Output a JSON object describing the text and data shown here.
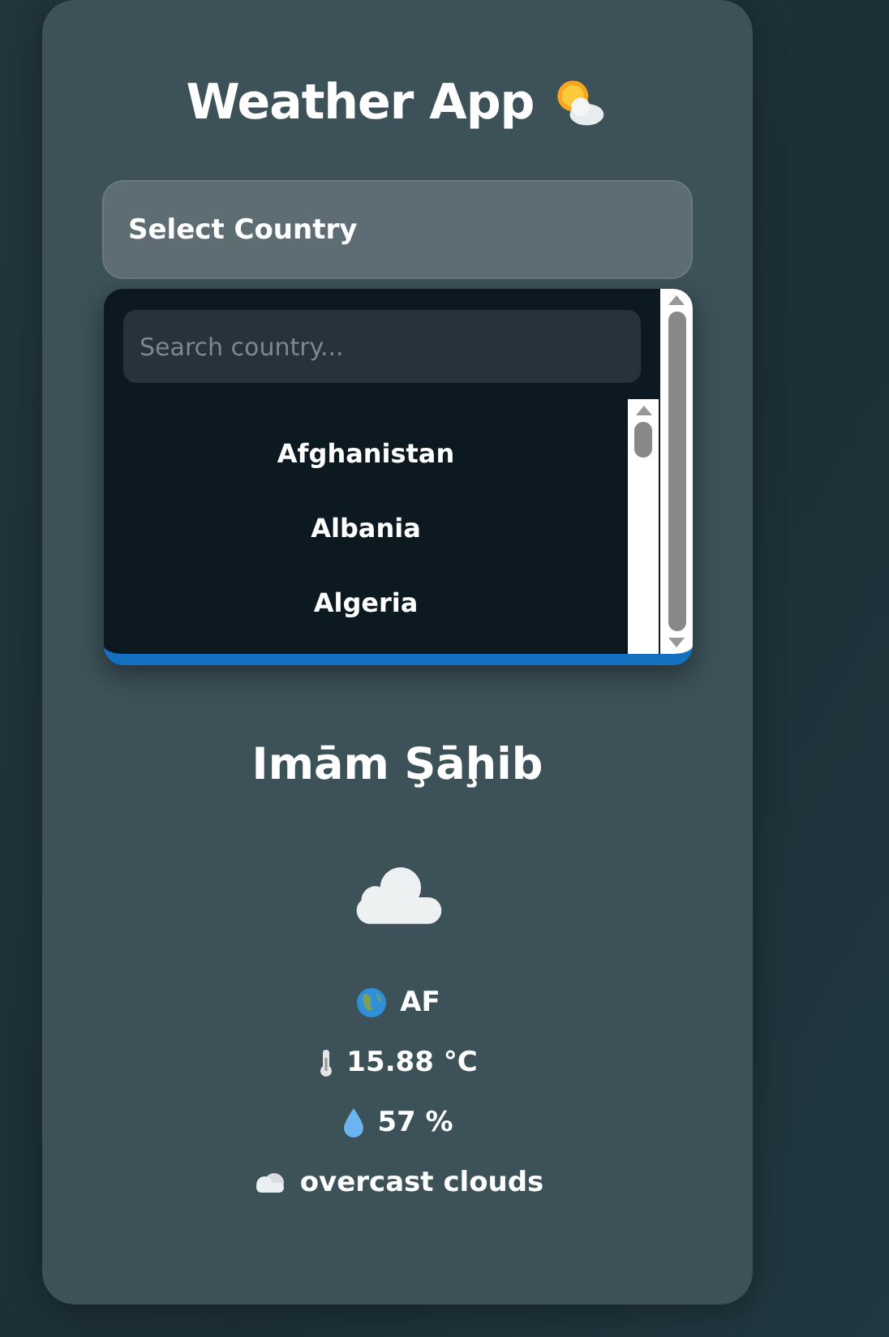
{
  "app": {
    "title": "Weather App"
  },
  "country_select": {
    "label": "Select Country",
    "expanded": true
  },
  "country_dropdown": {
    "search": {
      "placeholder": "Search country..."
    },
    "options": [
      {
        "label": "Afghanistan"
      },
      {
        "label": "Albania"
      },
      {
        "label": "Algeria"
      }
    ]
  },
  "weather": {
    "city": "Imām Şāḩib",
    "details": [
      {
        "kind": "country",
        "text": "AF"
      },
      {
        "kind": "temperature",
        "text": "15.88 °C"
      },
      {
        "kind": "humidity",
        "text": "57 %"
      },
      {
        "kind": "condition",
        "text": "overcast clouds"
      }
    ]
  }
}
